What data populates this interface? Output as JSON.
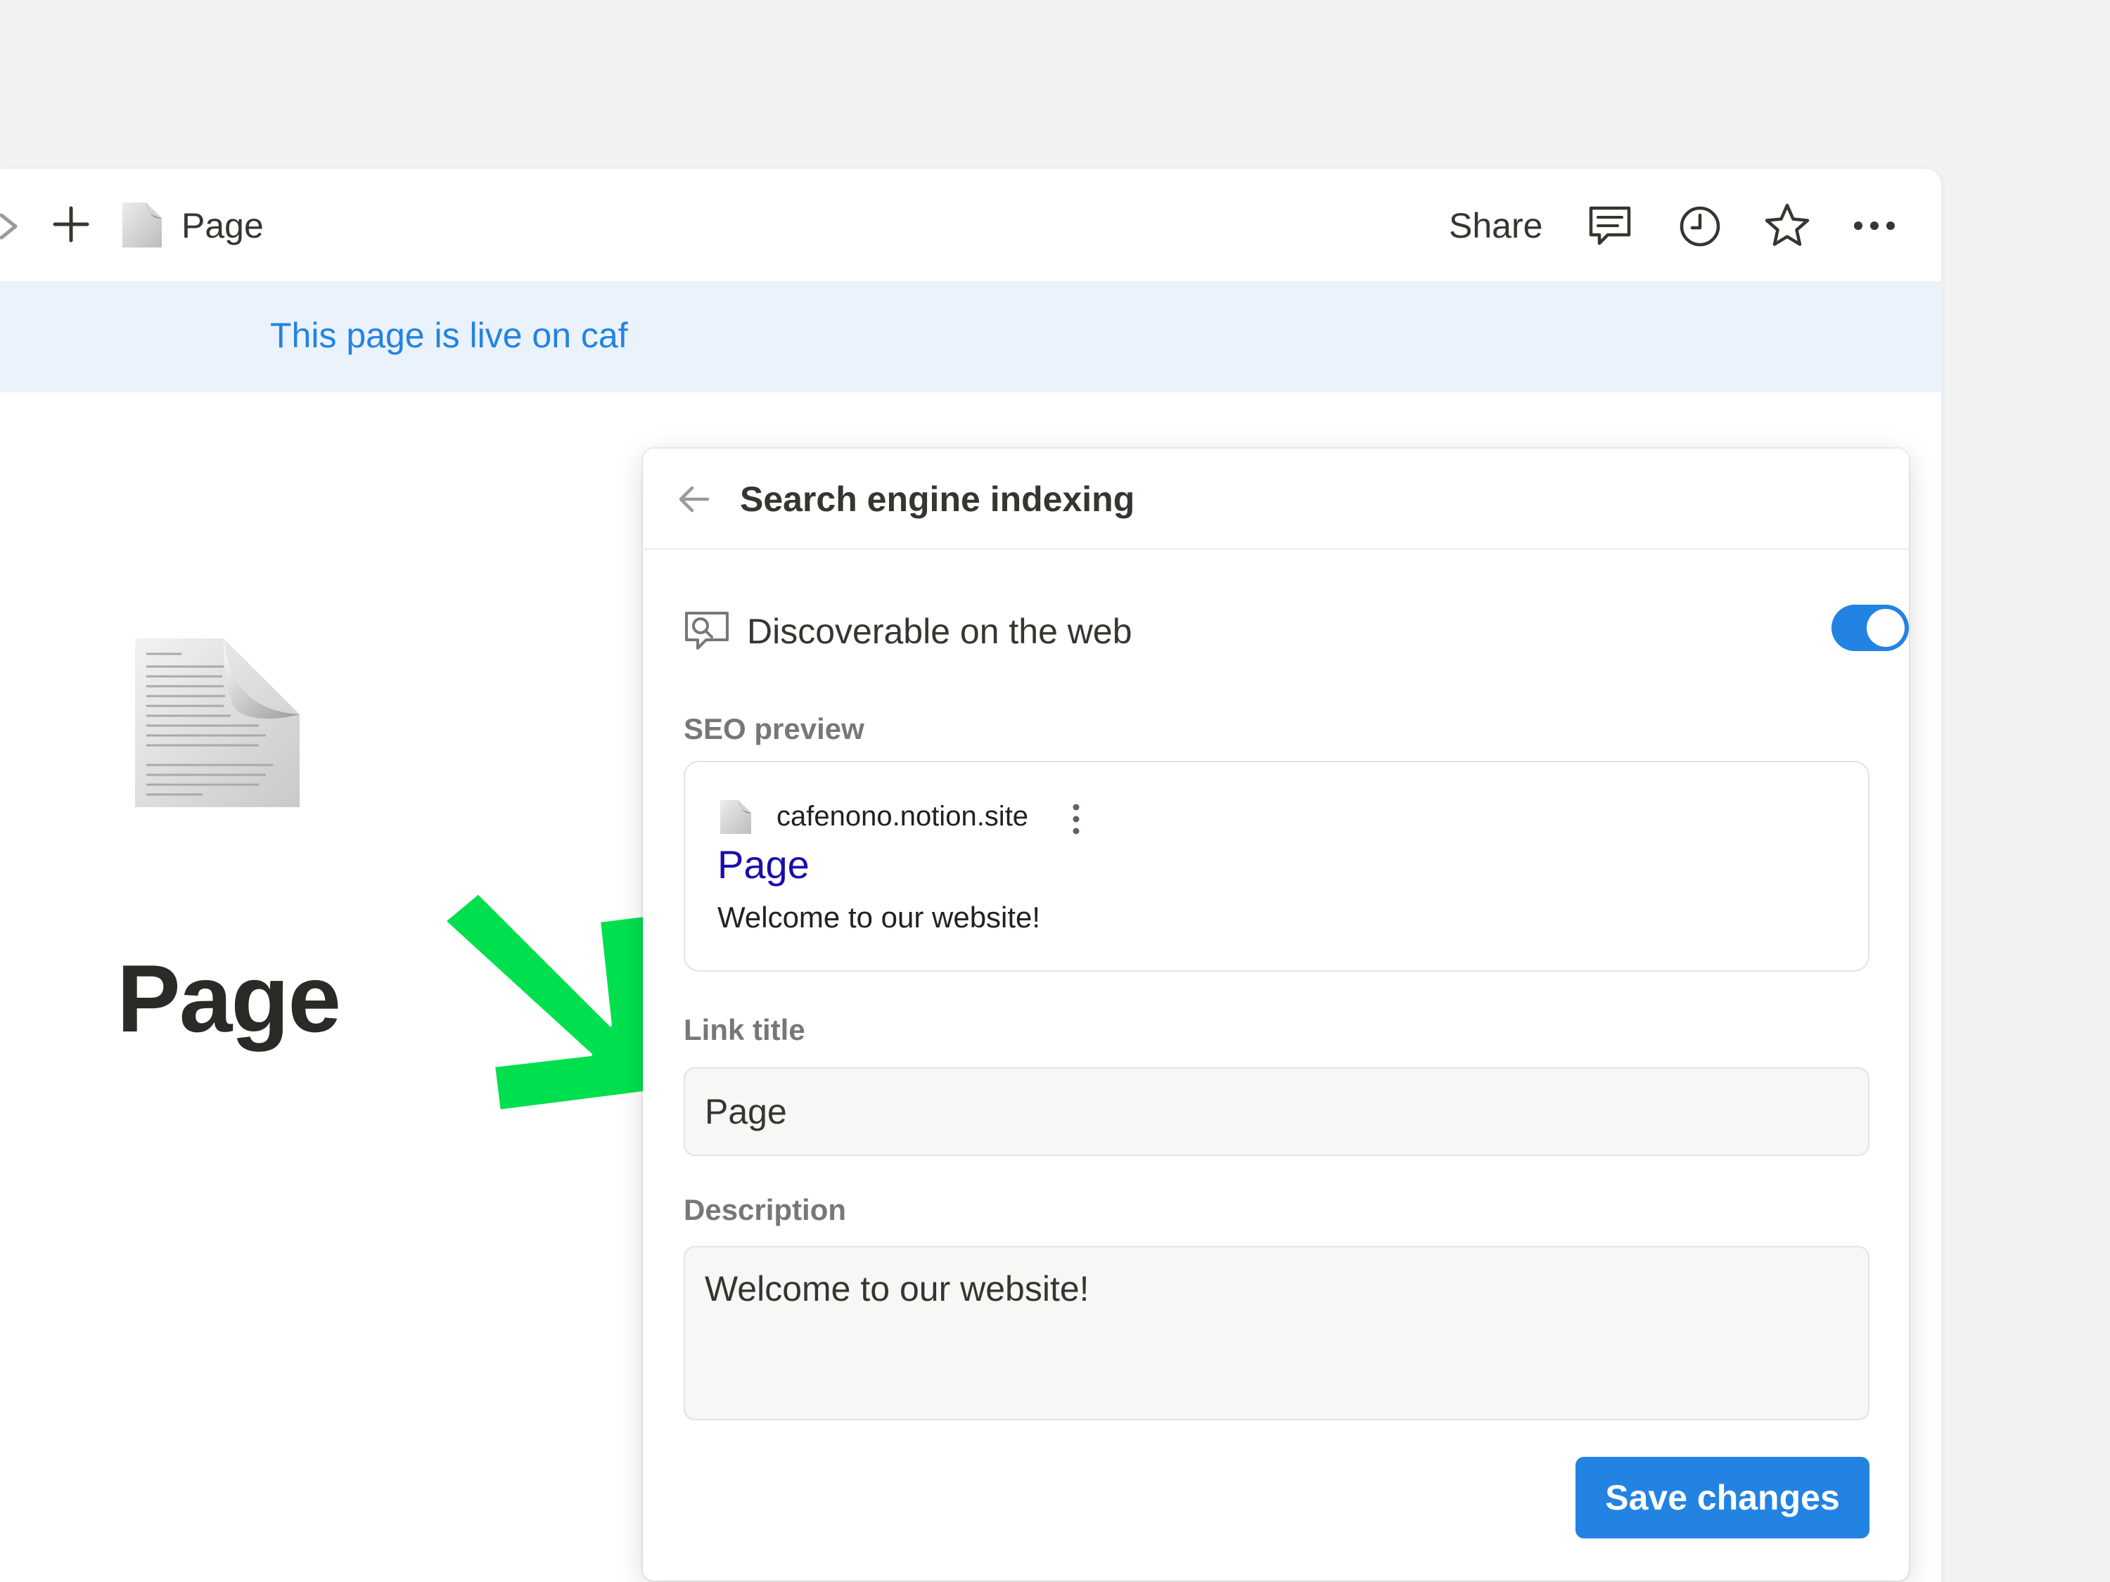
{
  "topbar": {
    "breadcrumb_title": "Page",
    "share_label": "Share",
    "icons": [
      "forward-arrow-icon",
      "plus-icon",
      "page-document-icon",
      "comment-icon",
      "clock-icon",
      "star-icon",
      "more-icon"
    ]
  },
  "banner": {
    "text": "This page is live on caf"
  },
  "page": {
    "title": "Page",
    "icon": "page-document-icon"
  },
  "annotation": {
    "arrow_color": "#00e04f"
  },
  "panel": {
    "title": "Search engine indexing",
    "back_icon": "back-arrow-icon",
    "discoverable": {
      "label": "Discoverable on the web",
      "icon": "search-bubble-icon",
      "enabled": true
    },
    "seo_preview": {
      "label": "SEO preview",
      "domain": "cafenono.notion.site",
      "title": "Page",
      "description": "Welcome to our website!"
    },
    "link_title": {
      "label": "Link title",
      "value": "Page"
    },
    "description": {
      "label": "Description",
      "value": "Welcome to our website!"
    },
    "save_label": "Save changes"
  },
  "colors": {
    "accent": "#2383e2",
    "seo_title": "#1a0dab",
    "banner_bg": "#eaf2fb",
    "page_bg": "#f2f2f2"
  }
}
